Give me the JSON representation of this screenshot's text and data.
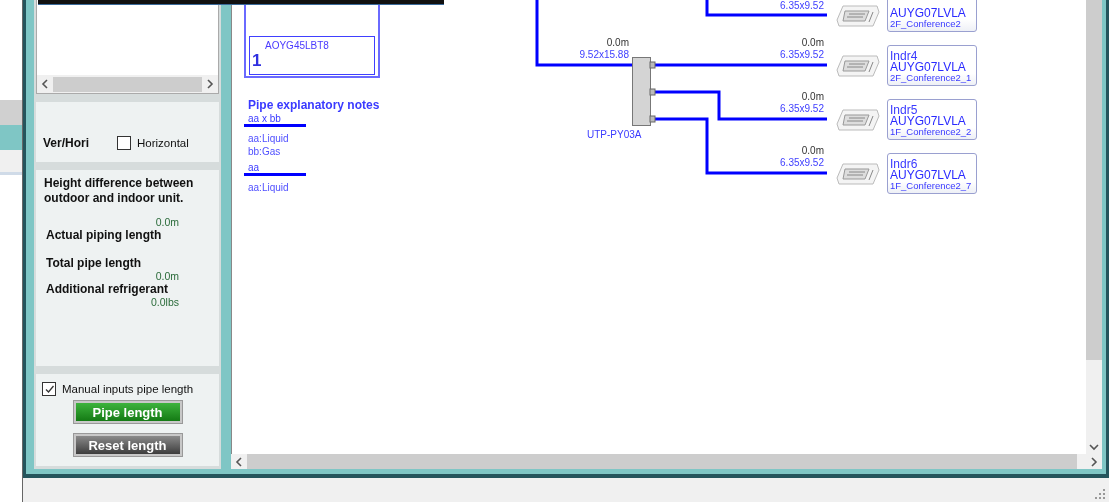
{
  "side_panel": {
    "orientation": {
      "label": "Ver/Hori",
      "option": "Horizontal",
      "checked": false
    },
    "height_difference": {
      "label": "Height difference between outdoor and indoor unit.",
      "value": "0.0m"
    },
    "actual_piping": {
      "label": "Actual piping length"
    },
    "total_pipe": {
      "label": "Total pipe length",
      "value": "0.0m"
    },
    "additional_refrigerant": {
      "label": "Additional refrigerant",
      "value": "0.0lbs"
    },
    "manual_inputs": {
      "label": "Manual inputs pipe length",
      "checked": true
    },
    "buttons": [
      {
        "label": "Pipe length",
        "kind": "primary"
      },
      {
        "label": "Reset length",
        "kind": "secondary"
      }
    ]
  },
  "diagram": {
    "outdoor_unit": {
      "model": "AOYG45LBT8",
      "number": "1"
    },
    "notes": {
      "title": "Pipe explanatory notes",
      "items": [
        {
          "sample": "aa x bb",
          "lines": [
            "aa:Liquid",
            "bb:Gas"
          ]
        },
        {
          "sample": "aa",
          "lines": [
            "aa:Liquid"
          ]
        }
      ]
    },
    "branch": {
      "name": "UTP-PY03A",
      "length": "0.0m",
      "size": "9.52x15.88"
    },
    "indoor_units": [
      {
        "size": "6.35x9.52",
        "model": "AUYG07LVLA",
        "room": "2F_Conference2"
      },
      {
        "length": "0.0m",
        "size": "6.35x9.52",
        "name": "Indr4",
        "model": "AUYG07LVLA",
        "room": "2F_Conference2_1"
      },
      {
        "length": "0.0m",
        "size": "6.35x9.52",
        "name": "Indr5",
        "model": "AUYG07LVLA",
        "room": "1F_Conference2_2"
      },
      {
        "length": "0.0m",
        "size": "6.35x9.52",
        "name": "Indr6",
        "model": "AUYG07LVLA",
        "room": "1F_Conference2_7"
      }
    ]
  }
}
